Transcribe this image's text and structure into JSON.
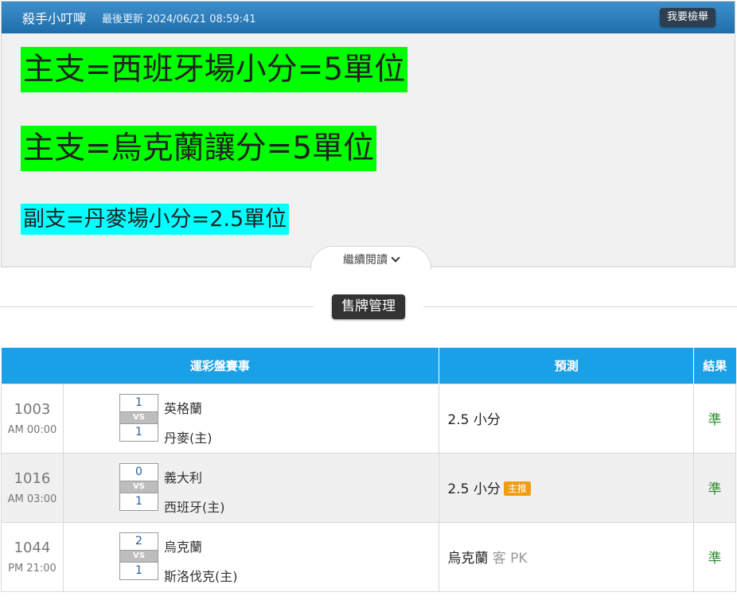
{
  "header": {
    "title": "殺手小叮嚀",
    "updated": "最後更新 2024/06/21 08:59:41",
    "report_button": "我要檢舉"
  },
  "content": {
    "lines": [
      "主支=西班牙場小分=5單位",
      "主支=烏克蘭讓分=5單位",
      "副支=丹麥場小分=2.5單位"
    ],
    "read_more": "繼續閱讀"
  },
  "sale_button": "售牌管理",
  "table": {
    "headers": [
      "運彩盤賽事",
      "預測",
      "結果"
    ],
    "vs_label": "VS",
    "rows": [
      {
        "code": "1003",
        "time": "AM 00:00",
        "score_top": "1",
        "score_bottom": "1",
        "team_top": "英格蘭",
        "team_bottom": "丹麥(主)",
        "prediction": "2.5 小分",
        "badge": "",
        "prediction_suffix": "",
        "result": "準"
      },
      {
        "code": "1016",
        "time": "AM 03:00",
        "score_top": "0",
        "score_bottom": "1",
        "team_top": "義大利",
        "team_bottom": "西班牙(主)",
        "prediction": "2.5 小分",
        "badge": "主推",
        "prediction_suffix": "",
        "result": "準"
      },
      {
        "code": "1044",
        "time": "PM 21:00",
        "score_top": "2",
        "score_bottom": "1",
        "team_top": "烏克蘭",
        "team_bottom": "斯洛伐克(主)",
        "prediction": "烏克蘭",
        "badge": "",
        "prediction_suffix": "客 PK",
        "result": "準"
      }
    ]
  }
}
